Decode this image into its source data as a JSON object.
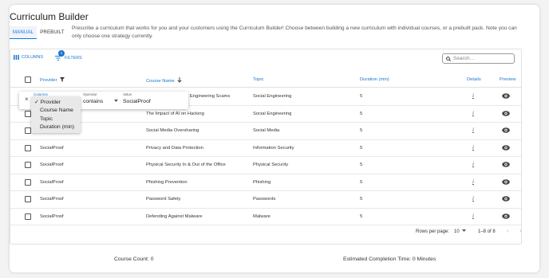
{
  "page_title": "Curriculum Builder",
  "tabs": [
    {
      "label": "MANUAL",
      "active": true
    },
    {
      "label": "PREBUILT",
      "active": false
    }
  ],
  "description": "Prescribe a curriculum that works for you and your customers using the Curriculum Builder! Choose between building a new curriculum with individual courses, or a prebuilt pack. Note you can only choose one strategy currently.",
  "toolbar": {
    "columns_label": "COLUMNS",
    "filters_label": "FILTERS",
    "filters_badge": "1",
    "search_placeholder": "Search…"
  },
  "columns": {
    "provider": "Provider",
    "course_name": "Course Name",
    "topic": "Topic",
    "duration": "Duration (min)",
    "details": "Details",
    "preview": "Preview"
  },
  "rows": [
    {
      "provider": "",
      "course": "Engineering Scams",
      "topic": "Social Engineering",
      "duration": "5",
      "info": "i"
    },
    {
      "provider": "",
      "course": "The Impact of AI on Hacking",
      "topic": "Social Engineering",
      "duration": "5",
      "info": "i"
    },
    {
      "provider": "",
      "course": "Social Media Oversharing",
      "topic": "Social Media",
      "duration": "5",
      "info": "i"
    },
    {
      "provider": "SocialProof",
      "course": "Privacy and Data Protection",
      "topic": "Information Security",
      "duration": "5",
      "info": "i"
    },
    {
      "provider": "SocialProof",
      "course": "Physical Security In & Out of the Office",
      "topic": "Physical Security",
      "duration": "5",
      "info": "i"
    },
    {
      "provider": "SocialProof",
      "course": "Phishing Prevention",
      "topic": "Phishing",
      "duration": "5",
      "info": "i"
    },
    {
      "provider": "SocialProof",
      "course": "Password Safety",
      "topic": "Passwords",
      "duration": "5",
      "info": "i"
    },
    {
      "provider": "SocialProof",
      "course": "Defending Against Malware",
      "topic": "Malware",
      "duration": "5",
      "info": "i"
    }
  ],
  "pagination": {
    "rows_per_page_label": "Rows per page:",
    "rows_per_page": "10",
    "range": "1–8 of 8"
  },
  "filter_panel": {
    "columns_label": "Columns",
    "operator_label": "Operator",
    "operator_value": "contains",
    "value_label": "Value",
    "value": "SocialProof",
    "options": [
      "Provider",
      "Course Name",
      "Topic",
      "Duration (min)"
    ],
    "selected": "Provider"
  },
  "summary": {
    "course_count": "Course Count: 0",
    "completion_time": "Estimated Completion Time: 0 Minutes"
  },
  "colors": {
    "accent": "#1976d2"
  }
}
